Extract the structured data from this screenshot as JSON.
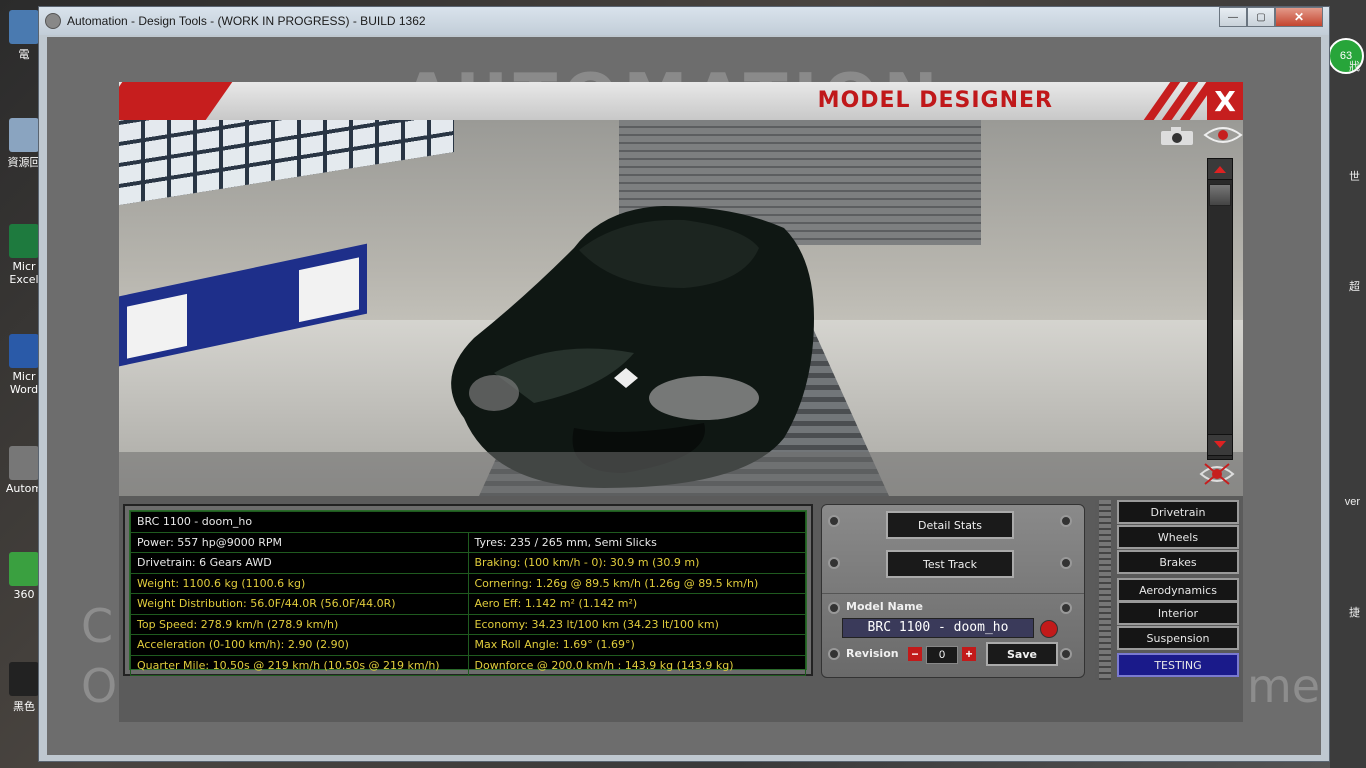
{
  "window": {
    "title": "Automation - Design Tools - (WORK IN PROGRESS) - BUILD 1362",
    "minimize": "—",
    "maximize": "▢",
    "close": "✕"
  },
  "background": {
    "logo": "AUTOMATION",
    "left_text_1": "C",
    "left_text_2": "O",
    "right_text": "me"
  },
  "desktop": {
    "icons": [
      "電",
      "資源回",
      "Micr Excel",
      "Micr Word",
      "Autom",
      "360",
      "黑色"
    ],
    "right_labels": [
      "63",
      "戕",
      "世",
      "超",
      "ver",
      "捷"
    ]
  },
  "designer": {
    "title": "MODEL DESIGNER",
    "close_label": "X"
  },
  "stats": {
    "rows": [
      {
        "left": "BRC 1100 - doom_ho",
        "right": "",
        "left_color": "w",
        "right_color": "w",
        "span": true
      },
      {
        "left": "Power: 557 hp@9000 RPM",
        "right": "Tyres: 235 / 265 mm, Semi Slicks",
        "left_color": "w",
        "right_color": "w"
      },
      {
        "left": "Drivetrain: 6 Gears AWD",
        "right": "Braking: (100 km/h - 0): 30.9 m (30.9 m)",
        "left_color": "w",
        "right_color": "y"
      },
      {
        "left": "Weight: 1100.6 kg (1100.6 kg)",
        "right": "Cornering: 1.26g @ 89.5 km/h (1.26g @ 89.5 km/h)",
        "left_color": "y",
        "right_color": "y"
      },
      {
        "left": "Weight Distribution: 56.0F/44.0R (56.0F/44.0R)",
        "right": "Aero Eff: 1.142 m² (1.142 m²)",
        "left_color": "y",
        "right_color": "y"
      },
      {
        "left": "Top Speed: 278.9 km/h (278.9 km/h)",
        "right": "Economy: 34.23 lt/100 km (34.23 lt/100 km)",
        "left_color": "y",
        "right_color": "y"
      },
      {
        "left": "Acceleration (0-100 km/h): 2.90 (2.90)",
        "right": "Max Roll Angle: 1.69° (1.69°)",
        "left_color": "y",
        "right_color": "y"
      },
      {
        "left": "Quarter Mile: 10.50s @ 219 km/h (10.50s @ 219 km/h)",
        "right": "Downforce @ 200.0 km/h : 143.9 kg (143.9 kg)",
        "left_color": "y",
        "right_color": "y"
      }
    ]
  },
  "controls": {
    "detail_stats": "Detail Stats",
    "test_track": "Test Track",
    "model_name_label": "Model Name",
    "model_name_value": "BRC 1100 - doom_ho",
    "revision_label": "Revision",
    "revision_minus": "−",
    "revision_value": "0",
    "revision_plus": "+",
    "save": "Save"
  },
  "nav": {
    "items": [
      "Drivetrain",
      "Wheels",
      "Brakes",
      "Aerodynamics",
      "Interior",
      "Suspension",
      "TESTING"
    ]
  },
  "colors": {
    "accent_red": "#c61e1e",
    "stat_white": "#e8e8e8",
    "stat_yellow": "#e0cc3c",
    "testing_blue": "#1a1a8a"
  }
}
